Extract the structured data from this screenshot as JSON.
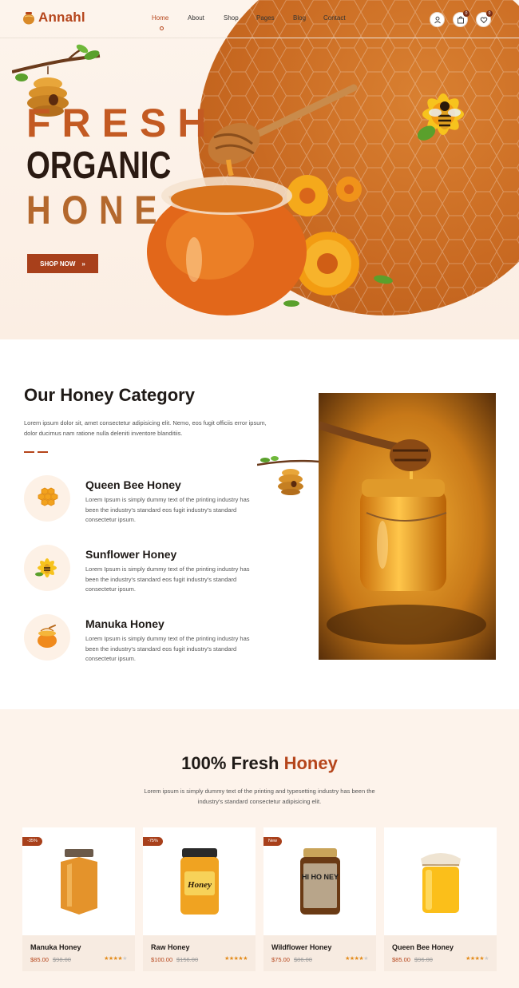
{
  "brand": {
    "name": "Annahl"
  },
  "nav": {
    "items": [
      "Home",
      "About",
      "Shop",
      "Pages",
      "Blog",
      "Contact"
    ],
    "active": "Home"
  },
  "header_icons": {
    "cart_count": "0",
    "wishlist_count": "0"
  },
  "hero": {
    "line1": "FRESH",
    "line2": "ORGANIC",
    "line3": "HONEY",
    "cta": "SHOP NOW",
    "cta_arrow": "»"
  },
  "category": {
    "title": "Our Honey Category",
    "description": "Lorem ipsum dolor sit, amet consectetur adipisicing elit. Nemo, eos fugit officiis error ipsum, dolor ducimus nam ratione nulla deleniti inventore blanditiis.",
    "items": [
      {
        "name": "Queen Bee Honey",
        "text": "Lorem Ipsum is simply dummy text of the printing industry has been the industry's standard eos fugit industry's standard consectetur ipsum."
      },
      {
        "name": "Sunflower Honey",
        "text": "Lorem Ipsum is simply dummy text of the printing industry has been the industry's standard eos fugit industry's standard consectetur ipsum."
      },
      {
        "name": "Manuka Honey",
        "text": "Lorem Ipsum is simply dummy text of the printing industry has been the industry's standard eos fugit industry's standard consectetur ipsum."
      }
    ]
  },
  "fresh": {
    "title_main": "100% Fresh",
    "title_accent": "Honey",
    "description": "Lorem ipsum is simply dummy text of the printing and typesetting industry has been the industry's standard consectetur adipisicing elit."
  },
  "products": [
    {
      "tag": "-35%",
      "name": "Manuka Honey",
      "price": "$85.00",
      "old_price": "$98.00",
      "rating": 4
    },
    {
      "tag": "-75%",
      "name": "Raw Honey",
      "price": "$100.00",
      "old_price": "$156.00",
      "rating": 5
    },
    {
      "tag": "New",
      "name": "Wildflower Honey",
      "price": "$75.00",
      "old_price": "$86.00",
      "rating": 4
    },
    {
      "tag": "",
      "name": "Queen Bee Honey",
      "price": "$85.00",
      "old_price": "$96.00",
      "rating": 4
    }
  ],
  "jar_labels": {
    "raw": "Honey",
    "wild": "HI HO NEY"
  },
  "colors": {
    "accent": "#b5451b",
    "orange": "#c96a22",
    "cream": "#fdf3eb",
    "dark": "#1f1a17"
  }
}
